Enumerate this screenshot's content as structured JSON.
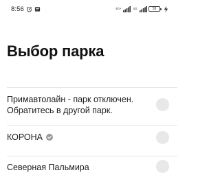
{
  "status_bar": {
    "time": "8:56",
    "network": [
      "4G+",
      "4G"
    ],
    "battery_level": "59"
  },
  "page": {
    "title": "Выбор парка"
  },
  "parks": [
    {
      "line1": "Примавтолайн - парк отключен.",
      "line2": "Обратитесь в другой парк.",
      "verified": false,
      "selected": false
    },
    {
      "line1": "КОРОНА",
      "verified": true,
      "selected": false
    },
    {
      "line1": "Северная Пальмира",
      "verified": false,
      "selected": false
    }
  ]
}
